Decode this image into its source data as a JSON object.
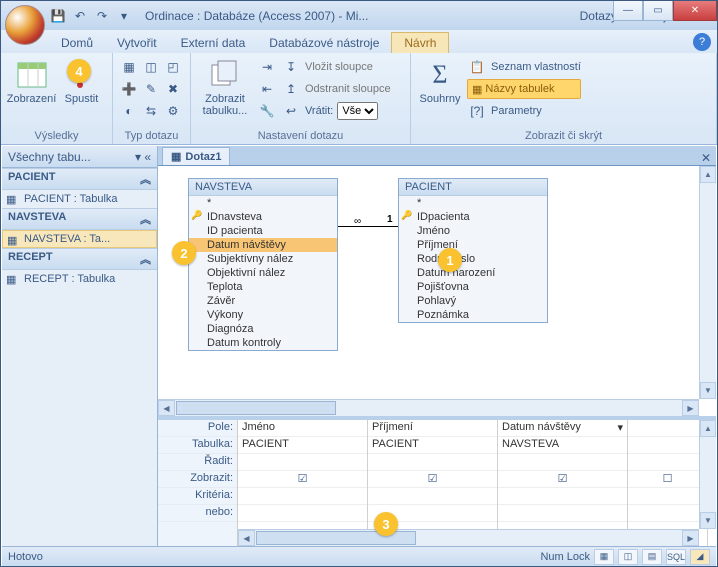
{
  "title": "Ordinace : Databáze (Access 2007) - Mi...",
  "context_title": "Dotazy – nástroje",
  "tabs": {
    "home": "Domů",
    "create": "Vytvořit",
    "external": "Externí data",
    "dbtools": "Databázové nástroje",
    "design": "Návrh"
  },
  "ribbon": {
    "results_grp": "Výsledky",
    "zobrazeni": "Zobrazení",
    "spustit": "Spustit",
    "querytype_grp": "Typ dotazu",
    "zobrazit_tabulku": "Zobrazit tabulku...",
    "insert_cols": "Vložit sloupce",
    "delete_cols": "Odstranit sloupce",
    "vratit_label": "Vrátit:",
    "vratit_value": "Vše",
    "setup_grp": "Nastavení dotazu",
    "souhrny": "Souhrny",
    "seznam_vlastnosti": "Seznam vlastností",
    "nazvy_tabulek": "Názvy tabulek",
    "parametry": "Parametry",
    "showhide_grp": "Zobrazit či skrýt"
  },
  "navpane": {
    "header": "Všechny tabu...",
    "groups": {
      "pacient": {
        "hdr": "PACIENT",
        "item": "PACIENT : Tabulka"
      },
      "navsteva": {
        "hdr": "NAVSTEVA",
        "item": "NAVSTEVA : Ta..."
      },
      "recept": {
        "hdr": "RECEPT",
        "item": "RECEPT : Tabulka"
      }
    }
  },
  "doc_tab": "Dotaz1",
  "designer": {
    "navsteva": {
      "title": "NAVSTEVA",
      "star": "*",
      "f0": "IDnavsteva",
      "f1": "ID pacienta",
      "f2": "Datum návštěvy",
      "f3": "Subjektívny nález",
      "f4": "Objektivní nález",
      "f5": "Teplota",
      "f6": "Závěr",
      "f7": "Výkony",
      "f8": "Diagnóza",
      "f9": "Datum kontroly"
    },
    "pacient": {
      "title": "PACIENT",
      "star": "*",
      "f0": "IDpacienta",
      "f1": "Jméno",
      "f2": "Příjmení",
      "f3": "Rodné číslo",
      "f4": "Datum narození",
      "f5": "Pojišťovna",
      "f6": "Pohlavý",
      "f7": "Poznámka"
    },
    "rel_inf": "∞",
    "rel_one": "1"
  },
  "grid": {
    "labels": {
      "pole": "Pole:",
      "tabulka": "Tabulka:",
      "radit": "Řadit:",
      "zobrazit": "Zobrazit:",
      "kriteria": "Kritéria:",
      "nebo": "nebo:"
    },
    "c1": {
      "pole": "Jméno",
      "tab": "PACIENT"
    },
    "c2": {
      "pole": "Příjmení",
      "tab": "PACIENT"
    },
    "c3": {
      "pole": "Datum návštěvy",
      "tab": "NAVSTEVA"
    }
  },
  "status": {
    "left": "Hotovo",
    "numlock": "Num Lock",
    "sql": "SQL"
  },
  "markers": {
    "m1": "1",
    "m2": "2",
    "m3": "3",
    "m4": "4"
  }
}
